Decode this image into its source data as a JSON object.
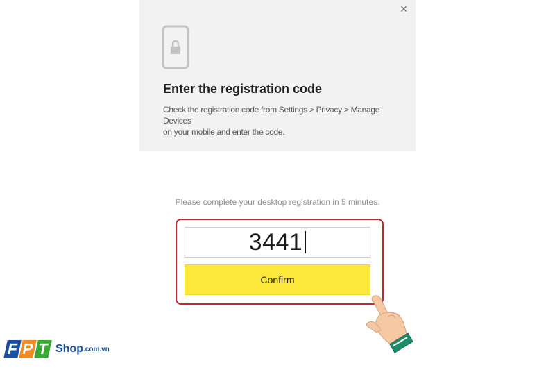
{
  "dialog": {
    "close_label": "×",
    "title": "Enter the registration code",
    "description_line1": "Check the registration code from Settings > Privacy > Manage",
    "description_line2": "Devices",
    "description_line3": "on your mobile and enter the code.",
    "notice": "Please complete your desktop registration in 5 minutes.",
    "code_value": "3441",
    "confirm_label": "Confirm"
  },
  "branding": {
    "letters": [
      "F",
      "P",
      "T"
    ],
    "shop": "Shop",
    "domain": ".com.vn"
  },
  "icons": {
    "close": "close-icon",
    "phone": "phone-lock-icon",
    "hand": "pointing-hand-icon"
  },
  "colors": {
    "confirm_button": "#fce83a",
    "highlight_border": "#c8252d",
    "header_background": "#f2f2f2"
  }
}
